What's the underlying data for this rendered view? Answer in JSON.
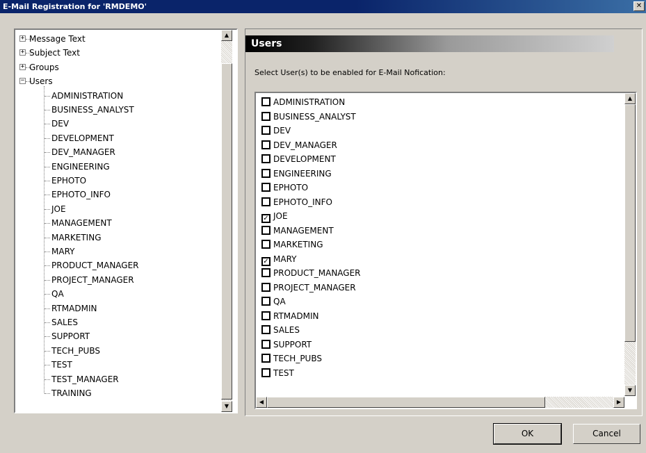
{
  "window": {
    "title": "E-Mail Registration for 'RMDEMO'",
    "close_glyph": "✕"
  },
  "tree": {
    "top_nodes": [
      {
        "label": "Message Text",
        "expander": "+"
      },
      {
        "label": "Subject Text",
        "expander": "+"
      },
      {
        "label": "Groups",
        "expander": "+"
      },
      {
        "label": "Users",
        "expander": "−"
      }
    ],
    "users": [
      "ADMINISTRATION",
      "BUSINESS_ANALYST",
      "DEV",
      "DEVELOPMENT",
      "DEV_MANAGER",
      "ENGINEERING",
      "EPHOTO",
      "EPHOTO_INFO",
      "JOE",
      "MANAGEMENT",
      "MARKETING",
      "MARY",
      "PRODUCT_MANAGER",
      "PROJECT_MANAGER",
      "QA",
      "RTMADMIN",
      "SALES",
      "SUPPORT",
      "TECH_PUBS",
      "TEST",
      "TEST_MANAGER",
      "TRAINING"
    ]
  },
  "panel": {
    "header": "Users",
    "instruction": "Select User(s) to be enabled for E-Mail Nofication:",
    "users": [
      {
        "name": "ADMINISTRATION",
        "checked": false
      },
      {
        "name": "BUSINESS_ANALYST",
        "checked": false
      },
      {
        "name": "DEV",
        "checked": false
      },
      {
        "name": "DEV_MANAGER",
        "checked": false
      },
      {
        "name": "DEVELOPMENT",
        "checked": false
      },
      {
        "name": "ENGINEERING",
        "checked": false
      },
      {
        "name": "EPHOTO",
        "checked": false
      },
      {
        "name": "EPHOTO_INFO",
        "checked": false
      },
      {
        "name": "JOE",
        "checked": true
      },
      {
        "name": "MANAGEMENT",
        "checked": false
      },
      {
        "name": "MARKETING",
        "checked": false
      },
      {
        "name": "MARY",
        "checked": true
      },
      {
        "name": "PRODUCT_MANAGER",
        "checked": false
      },
      {
        "name": "PROJECT_MANAGER",
        "checked": false
      },
      {
        "name": "QA",
        "checked": false
      },
      {
        "name": "RTMADMIN",
        "checked": false
      },
      {
        "name": "SALES",
        "checked": false
      },
      {
        "name": "SUPPORT",
        "checked": false
      },
      {
        "name": "TECH_PUBS",
        "checked": false
      },
      {
        "name": "TEST",
        "checked": false
      }
    ]
  },
  "buttons": {
    "ok": "OK",
    "cancel": "Cancel"
  },
  "icons": {
    "arrow_up": "▲",
    "arrow_down": "▼",
    "arrow_left": "◀",
    "arrow_right": "▶",
    "check": "✓"
  }
}
